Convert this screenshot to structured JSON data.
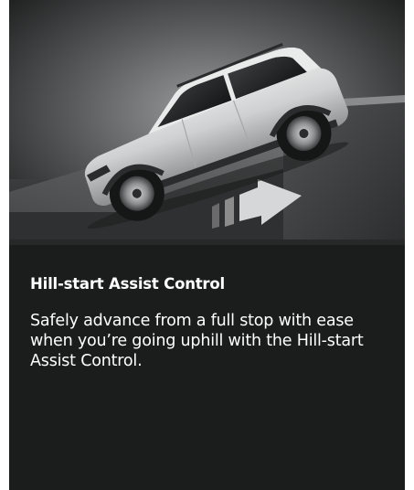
{
  "feature": {
    "title": "Hill-start Assist Control",
    "description": "Safely advance from a full stop with ease when you’re going uphill with the Hill-start Assist Control."
  },
  "colors": {
    "panel_background": "#1b1c1c",
    "text": "#ffffff"
  },
  "hero": {
    "subject": "silver SUV climbing a ramp with a forward arrow"
  }
}
